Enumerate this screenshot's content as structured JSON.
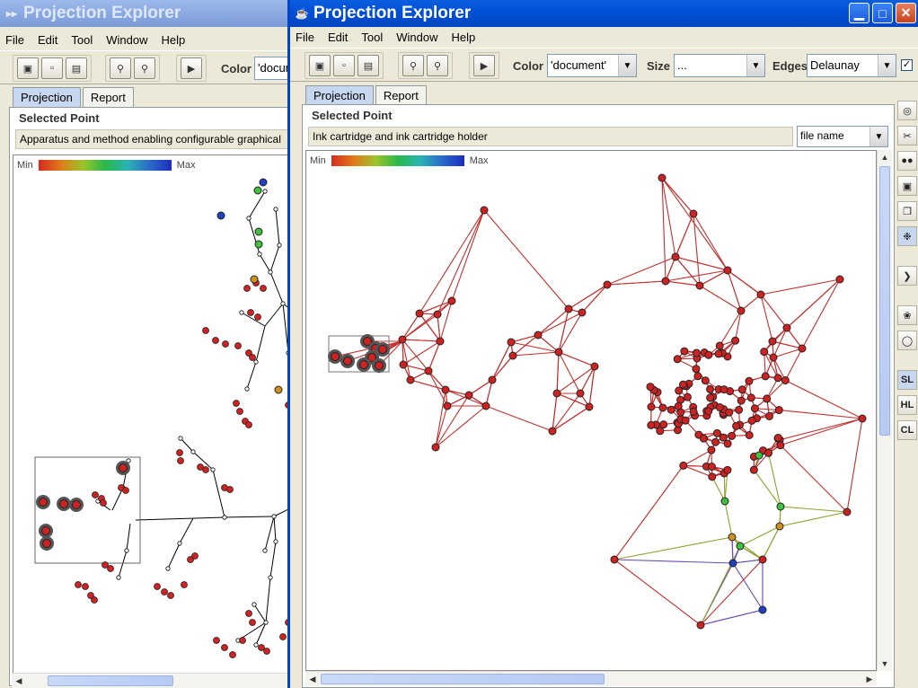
{
  "back_window": {
    "title": "Projection Explorer",
    "menu": [
      "File",
      "Edit",
      "Tool",
      "Window",
      "Help"
    ],
    "color_label": "Color",
    "color_value": "'docum",
    "tabs": [
      "Projection",
      "Report"
    ],
    "selected_point_title": "Selected Point",
    "selected_point_value": "Apparatus and method enabling configurable graphical",
    "legend_min": "Min",
    "legend_max": "Max"
  },
  "front_window": {
    "title": "Projection Explorer",
    "menu": [
      "File",
      "Edit",
      "Tool",
      "Window",
      "Help"
    ],
    "color_label": "Color",
    "color_value": "'document'",
    "size_label": "Size",
    "size_value": "...",
    "edges_label": "Edges",
    "edges_value": "Delaunay",
    "tabs": [
      "Projection",
      "Report"
    ],
    "selected_point_title": "Selected Point",
    "selected_point_value": "Ink cartridge and ink cartridge holder",
    "label_field_value": "file name",
    "legend_min": "Min",
    "legend_max": "Max",
    "side_tools": [
      "SL",
      "HL",
      "CL"
    ]
  },
  "colors": {
    "titlebar_active": "#0050d8",
    "node_red": "#cc2222",
    "edge_red": "#c03030",
    "node_green": "#40c040",
    "node_orange": "#d09020",
    "node_blue": "#2040c0"
  },
  "icons": {
    "toolbar": [
      "new-icon",
      "open-icon",
      "save-icon",
      "zoom-in-icon",
      "zoom-out-icon",
      "play-icon"
    ],
    "side": [
      "circle-icon",
      "scissors-icon",
      "binoculars-icon",
      "frame-icon",
      "copy-icon",
      "cluster-icon",
      "chevron-right-icon",
      "tool-icon",
      "speech-icon"
    ]
  }
}
